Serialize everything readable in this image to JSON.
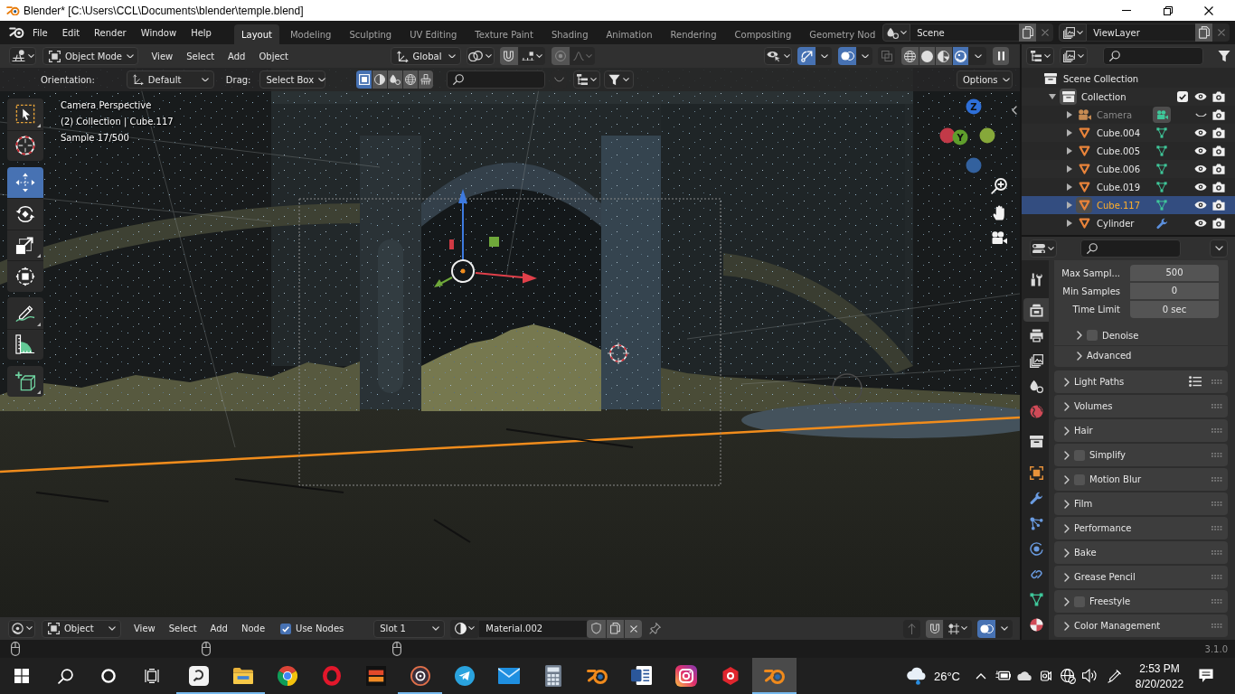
{
  "window": {
    "title": "Blender* [C:\\Users\\CCL\\Documents\\blender\\temple.blend]"
  },
  "topbar": {
    "menu": [
      "File",
      "Edit",
      "Render",
      "Window",
      "Help"
    ],
    "workspaces": [
      {
        "label": "Layout",
        "selected": true
      },
      {
        "label": "Modeling",
        "selected": false
      },
      {
        "label": "Sculpting",
        "selected": false
      },
      {
        "label": "UV Editing",
        "selected": false
      },
      {
        "label": "Texture Paint",
        "selected": false
      },
      {
        "label": "Shading",
        "selected": false
      },
      {
        "label": "Animation",
        "selected": false
      },
      {
        "label": "Rendering",
        "selected": false
      },
      {
        "label": "Compositing",
        "selected": false
      },
      {
        "label": "Geometry Nod",
        "selected": false
      }
    ],
    "scene": "Scene",
    "view_layer": "ViewLayer"
  },
  "viewport_header": {
    "mode": "Object Mode",
    "menu": [
      "View",
      "Select",
      "Add",
      "Object"
    ],
    "orientation": "Global",
    "snap": false,
    "proportional": false,
    "gizmos": true,
    "overlays": true,
    "xray": false,
    "shading": [
      {
        "kind": "wireframe",
        "selected": false
      },
      {
        "kind": "solid",
        "selected": false
      },
      {
        "kind": "material",
        "selected": false
      },
      {
        "kind": "rendered",
        "selected": true
      }
    ]
  },
  "tool_settings": {
    "orientation_label": "Orientation:",
    "orientation": "Default",
    "drag_label": "Drag:",
    "drag": "Select Box",
    "select_modes": [
      {
        "kind": "square",
        "selected": true
      },
      {
        "kind": "half",
        "selected": false
      },
      {
        "kind": "drops",
        "selected": false
      },
      {
        "kind": "globe",
        "selected": false
      },
      {
        "kind": "brush",
        "selected": false
      }
    ],
    "options": "Options"
  },
  "viewport": {
    "info": [
      "Camera Perspective",
      "(2) Collection | Cube.117",
      "Sample 17/500"
    ],
    "tool_groups": [
      {
        "tools": [
          {
            "kind": "select-box",
            "selected": false,
            "submenu": true
          },
          {
            "kind": "cursor",
            "selected": false,
            "submenu": false
          }
        ]
      },
      {
        "tools": [
          {
            "kind": "move",
            "selected": true,
            "submenu": false
          },
          {
            "kind": "rotate",
            "selected": false,
            "submenu": false
          },
          {
            "kind": "scale",
            "selected": false,
            "submenu": true
          },
          {
            "kind": "transform",
            "selected": false,
            "submenu": false
          }
        ]
      },
      {
        "tools": [
          {
            "kind": "annotate",
            "selected": false,
            "submenu": true
          },
          {
            "kind": "measure",
            "selected": false,
            "submenu": false
          }
        ]
      },
      {
        "tools": [
          {
            "kind": "add-cube",
            "selected": false,
            "submenu": true
          }
        ]
      }
    ],
    "nav_gizmo": {
      "axes": [
        {
          "label": "Z",
          "color": "#2e6fd8"
        },
        {
          "color": "#c23a48"
        },
        {
          "label": "Y",
          "color": "#5f9e2c"
        },
        {
          "color": "#86a83a"
        },
        {
          "color": "#33619e"
        }
      ]
    }
  },
  "node_header": {
    "mode": "Object",
    "menu": [
      "View",
      "Select",
      "Add",
      "Node"
    ],
    "use_nodes": {
      "label": "Use Nodes",
      "checked": true
    },
    "slot": "Slot 1",
    "material": "Material.002",
    "snap": false,
    "overlays": true
  },
  "outliner": {
    "root": {
      "label": "Scene Collection",
      "selected": false,
      "children": [
        {
          "label": "Collection",
          "active": true,
          "expanded": true,
          "checked": true,
          "visible": true,
          "selected": false,
          "children": [
            {
              "label": "Camera",
              "kind": "camera",
              "expanded": false,
              "visible": false,
              "selected": false
            },
            {
              "label": "Cube.004",
              "kind": "mesh",
              "expanded": false,
              "visible": true,
              "selected": false
            },
            {
              "label": "Cube.005",
              "kind": "mesh",
              "expanded": false,
              "visible": true,
              "selected": false
            },
            {
              "label": "Cube.006",
              "kind": "mesh",
              "expanded": false,
              "visible": true,
              "selected": false
            },
            {
              "label": "Cube.019",
              "kind": "mesh",
              "expanded": false,
              "visible": true,
              "selected": false
            },
            {
              "label": "Cube.117",
              "kind": "mesh",
              "expanded": false,
              "visible": true,
              "selected": true
            },
            {
              "label": "Cylinder",
              "kind": "modified",
              "expanded": false,
              "visible": true,
              "selected": false
            }
          ]
        }
      ]
    }
  },
  "properties": {
    "tab_groups": [
      {
        "tabs": [
          {
            "kind": "tool",
            "selected": false
          }
        ]
      },
      {
        "tabs": [
          {
            "kind": "render",
            "selected": true
          },
          {
            "kind": "output",
            "selected": false
          },
          {
            "kind": "view-layer",
            "selected": false
          },
          {
            "kind": "scene",
            "selected": false
          },
          {
            "kind": "world",
            "selected": false
          }
        ]
      },
      {
        "tabs": [
          {
            "kind": "collection",
            "selected": false
          }
        ]
      },
      {
        "tabs": [
          {
            "kind": "object",
            "selected": false
          },
          {
            "kind": "modifiers",
            "selected": false
          },
          {
            "kind": "particles",
            "selected": false
          },
          {
            "kind": "physics",
            "selected": false
          },
          {
            "kind": "constraints",
            "selected": false
          },
          {
            "kind": "data",
            "selected": false
          },
          {
            "kind": "material",
            "selected": false
          }
        ]
      }
    ],
    "fields": [
      {
        "label": "Max Sampl...",
        "value": "500"
      },
      {
        "label": "Min Samples",
        "value": "0"
      },
      {
        "label": "Time Limit",
        "value": "0 sec"
      }
    ],
    "subpanels": [
      {
        "label": "Denoise",
        "kind": "checkbox",
        "checked": false,
        "expanded": false
      },
      {
        "label": "Advanced",
        "kind": "plain",
        "expanded": false
      }
    ],
    "panels": [
      {
        "label": "Light Paths",
        "kind": "presets",
        "expanded": false
      },
      {
        "label": "Volumes",
        "kind": "plain",
        "expanded": false
      },
      {
        "label": "Hair",
        "kind": "plain",
        "expanded": false
      },
      {
        "label": "Simplify",
        "kind": "checkbox",
        "checked": false,
        "expanded": false
      },
      {
        "label": "Motion Blur",
        "kind": "checkbox",
        "checked": false,
        "expanded": false
      },
      {
        "label": "Film",
        "kind": "plain",
        "expanded": false
      },
      {
        "label": "Performance",
        "kind": "plain",
        "expanded": false
      },
      {
        "label": "Bake",
        "kind": "plain",
        "expanded": false
      },
      {
        "label": "Grease Pencil",
        "kind": "plain",
        "expanded": false
      },
      {
        "label": "Freestyle",
        "kind": "checkbox",
        "checked": false,
        "expanded": false
      },
      {
        "label": "Color Management",
        "kind": "plain",
        "expanded": false
      }
    ]
  },
  "status_bar": {
    "version": "3.1.0"
  },
  "taskbar": {
    "apps": [
      {
        "kind": "tile",
        "open": true,
        "selected": false
      },
      {
        "kind": "folder",
        "open": true,
        "selected": false
      },
      {
        "kind": "wheel",
        "open": false,
        "selected": false
      },
      {
        "kind": "ring",
        "open": false,
        "selected": false
      },
      {
        "kind": "game",
        "open": false,
        "selected": false
      },
      {
        "kind": "disc",
        "open": true,
        "selected": false
      },
      {
        "kind": "plane",
        "open": false,
        "selected": false
      },
      {
        "kind": "mail",
        "open": false,
        "selected": false
      },
      {
        "kind": "calc",
        "open": false,
        "selected": false
      },
      {
        "kind": "logo",
        "open": false,
        "selected": false
      },
      {
        "kind": "doc",
        "open": false,
        "selected": false
      },
      {
        "kind": "insta",
        "open": false,
        "selected": false
      },
      {
        "kind": "badge",
        "open": false,
        "selected": false
      },
      {
        "kind": "logo",
        "open": true,
        "selected": true
      }
    ],
    "temperature": "26°C",
    "time": "2:53 PM",
    "date": "8/20/2022"
  }
}
